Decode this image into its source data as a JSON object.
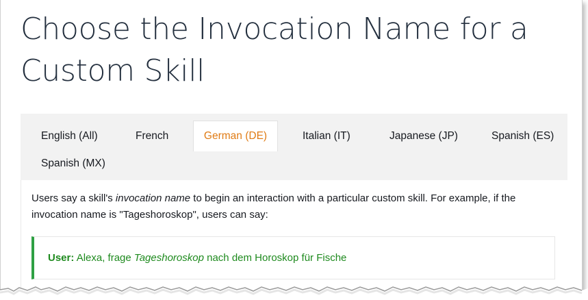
{
  "page": {
    "title": "Choose the Invocation Name for a Custom Skill"
  },
  "tabs": [
    {
      "label": "English (All)",
      "active": false
    },
    {
      "label": "French",
      "active": false
    },
    {
      "label": "German (DE)",
      "active": true
    },
    {
      "label": "Italian (IT)",
      "active": false
    },
    {
      "label": "Japanese (JP)",
      "active": false
    },
    {
      "label": "Spanish (ES)",
      "active": false
    },
    {
      "label": "Spanish (MX)",
      "active": false
    }
  ],
  "content": {
    "intro_part1": "Users say a skill's ",
    "intro_em": "invocation name",
    "intro_part2": " to begin an interaction with a particular custom skill. For example, if the invocation name is \"Tageshoroskop\", users can say:",
    "example": {
      "speaker": "User:",
      "text_before": " Alexa, frage ",
      "text_em": "Tageshoroskop",
      "text_after": " nach dem Horoskop für Fische"
    }
  },
  "colors": {
    "active_tab": "#e07b14",
    "example_text": "#1e8a1e",
    "example_border": "#2ea043",
    "tab_bar_bg": "#f2f2f2"
  }
}
